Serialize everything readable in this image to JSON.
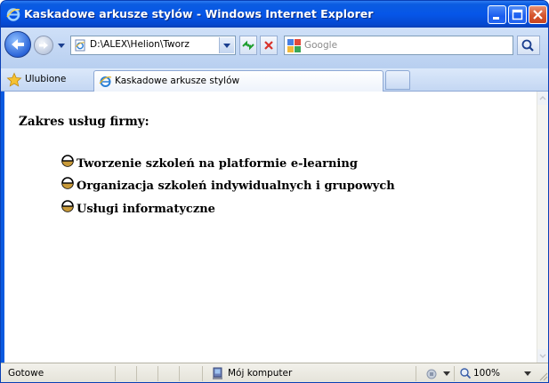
{
  "window": {
    "title": "Kaskadowe arkusze stylów - Windows Internet Explorer"
  },
  "navbar": {
    "address": "D:\\ALEX\\Helion\\Tworz",
    "search_placeholder": "Google"
  },
  "tabs": {
    "favorites_label": "Ulubione",
    "active_tab_label": "Kaskadowe arkusze stylów"
  },
  "page": {
    "heading": "Zakres usług firmy:",
    "items": [
      {
        "label": "Tworzenie szkoleń na platformie e-learning"
      },
      {
        "label": "Organizacja szkoleń indywidualnych i grupowych"
      },
      {
        "label": "Usługi informatyczne"
      }
    ]
  },
  "statusbar": {
    "status": "Gotowe",
    "zone": "Mój komputer",
    "zoom": "100%"
  },
  "colors": {
    "titlebar": "#0656e8",
    "title_text": "#ffffff",
    "close_button": "#d5562e",
    "chrome_bg": "#c4d7f3",
    "content_bg": "#ffffff"
  },
  "icons": {
    "title": "ie-logo-icon",
    "back": "back-arrow-icon",
    "forward": "forward-arrow-icon",
    "refresh": "refresh-icon",
    "stop": "stop-icon",
    "search_provider": "google-icon",
    "search": "magnifier-icon",
    "favorites": "star-icon",
    "bullet": "half-filled-circle-icon",
    "zone": "computer-icon",
    "zoom": "magnifier-icon"
  }
}
